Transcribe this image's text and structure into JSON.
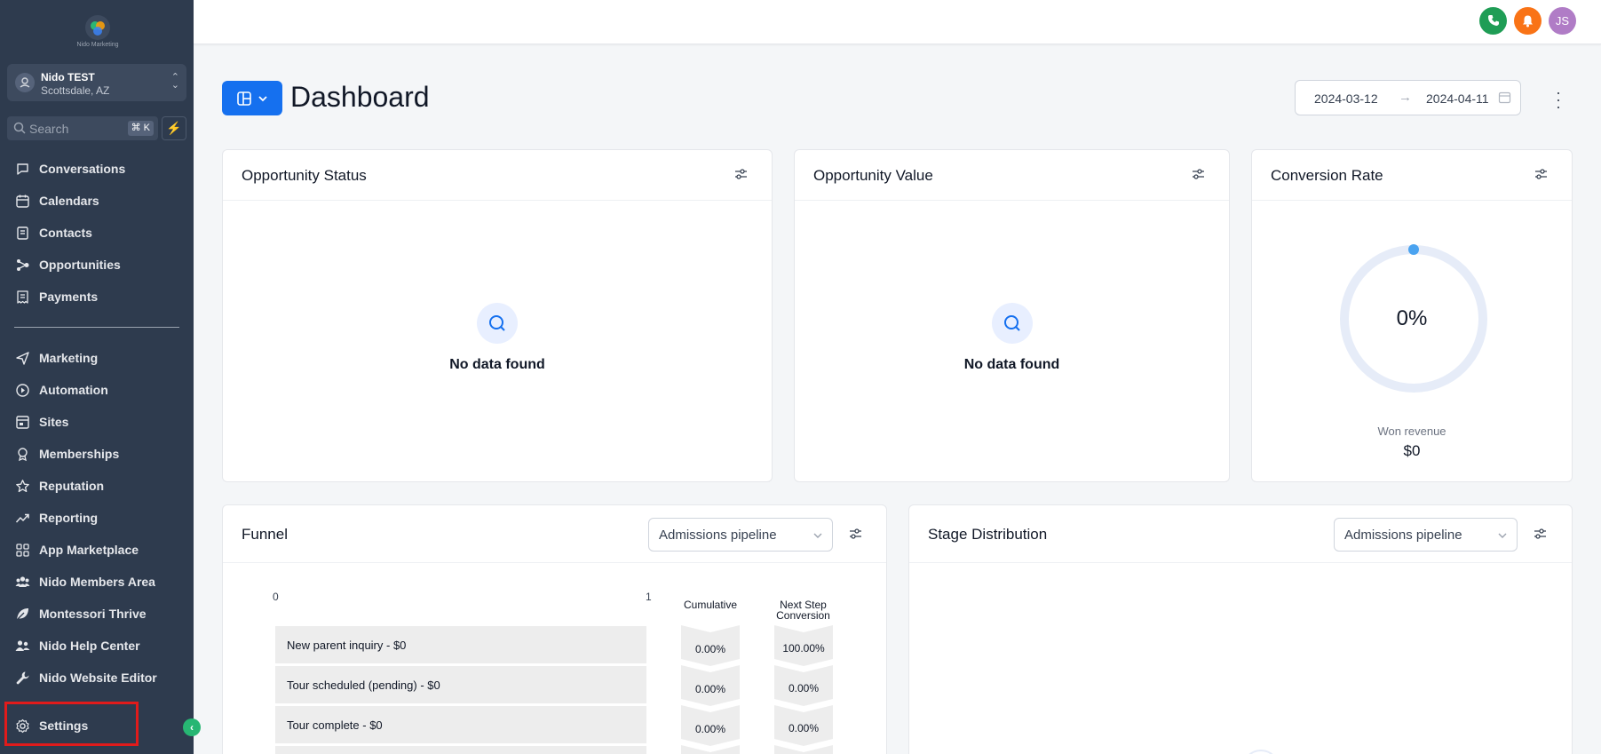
{
  "brand": {
    "logo_text": "Nido Marketing"
  },
  "account": {
    "name": "Nido TEST",
    "location": "Scottsdale, AZ"
  },
  "search": {
    "placeholder": "Search",
    "shortcut": "⌘ K"
  },
  "nav": {
    "primary": [
      {
        "label": "Conversations",
        "icon": "chat-bubble-icon"
      },
      {
        "label": "Calendars",
        "icon": "calendar-icon"
      },
      {
        "label": "Contacts",
        "icon": "contacts-book-icon"
      },
      {
        "label": "Opportunities",
        "icon": "opportunities-icon"
      },
      {
        "label": "Payments",
        "icon": "receipt-icon"
      }
    ],
    "secondary": [
      {
        "label": "Marketing",
        "icon": "send-icon"
      },
      {
        "label": "Automation",
        "icon": "automation-icon"
      },
      {
        "label": "Sites",
        "icon": "sites-icon"
      },
      {
        "label": "Memberships",
        "icon": "badge-icon"
      },
      {
        "label": "Reputation",
        "icon": "star-icon"
      },
      {
        "label": "Reporting",
        "icon": "trend-icon"
      },
      {
        "label": "App Marketplace",
        "icon": "grid-icon"
      },
      {
        "label": "Nido Members Area",
        "icon": "members-icon"
      },
      {
        "label": "Montessori Thrive",
        "icon": "leaf-icon"
      },
      {
        "label": "Nido Help Center",
        "icon": "help-people-icon"
      },
      {
        "label": "Nido Website Editor",
        "icon": "wrench-icon"
      }
    ],
    "settings": {
      "label": "Settings",
      "icon": "gear-icon"
    }
  },
  "topbar": {
    "avatar_initials": "JS",
    "colors": {
      "phone": "#1f9d55",
      "bell": "#f97316",
      "avatar": "#b07cc6"
    }
  },
  "page": {
    "title": "Dashboard"
  },
  "date_range": {
    "from": "2024-03-12",
    "to": "2024-04-11"
  },
  "cards": {
    "opportunity_status": {
      "title": "Opportunity Status",
      "empty": "No data found"
    },
    "opportunity_value": {
      "title": "Opportunity Value",
      "empty": "No data found"
    },
    "conversion_rate": {
      "title": "Conversion Rate",
      "value": "0%",
      "won_label": "Won revenue",
      "won_value": "$0",
      "fraction": 0
    },
    "funnel": {
      "title": "Funnel",
      "pipeline": "Admissions pipeline",
      "axis": {
        "min": "0",
        "max": "1"
      },
      "col_cumulative": "Cumulative",
      "col_next": "Next Step Conversion",
      "stages": [
        {
          "label": "New parent inquiry - $0",
          "cumulative": "0.00%",
          "next": "100.00%"
        },
        {
          "label": "Tour scheduled (pending) - $0",
          "cumulative": "0.00%",
          "next": "0.00%"
        },
        {
          "label": "Tour complete - $0",
          "cumulative": "0.00%",
          "next": "0.00%"
        }
      ]
    },
    "stage_distribution": {
      "title": "Stage Distribution",
      "pipeline": "Admissions pipeline"
    }
  },
  "colors": {
    "sidebar": "#2e3b4e",
    "primary": "#1570ef",
    "highlight": "#e11b1b",
    "ring": "#e6ecf8",
    "ring_dot": "#4aa3f0"
  }
}
